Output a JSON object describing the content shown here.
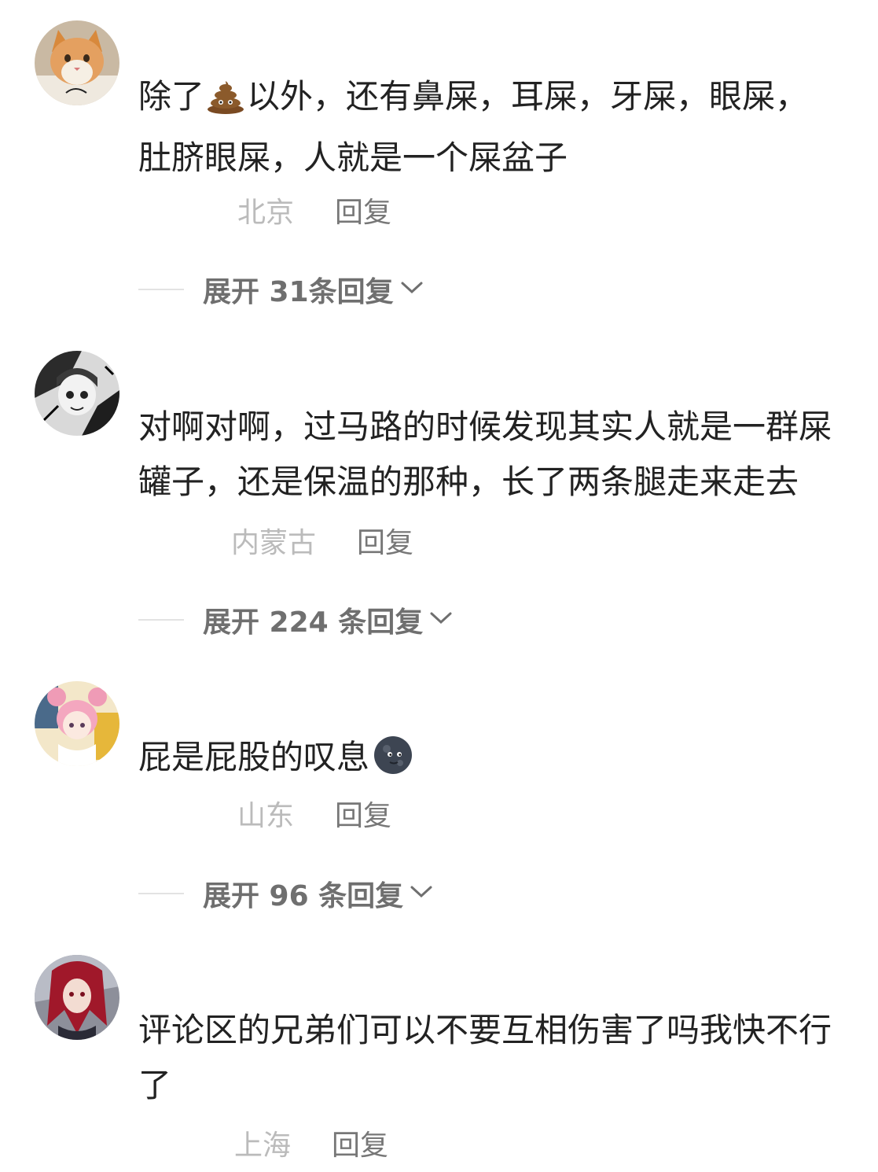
{
  "comments": [
    {
      "avatar_icon": "cat-avatar",
      "lines": [
        "除了",
        "以外，还有鼻屎，耳屎，牙屎，眼屎，",
        "肚脐眼屎，人就是一个屎盆子"
      ],
      "emoji": "poop-emoji",
      "region": "北京",
      "reply_label": "回复",
      "expand_label": "展开 31条回复"
    },
    {
      "avatar_icon": "manga-avatar",
      "lines": [
        "对啊对啊，过马路的时候发现其实人就是一群屎",
        "罐子，还是保温的那种，长了两条腿走来走去"
      ],
      "region": "内蒙古",
      "reply_label": "回复",
      "expand_label": "展开 224 条回复"
    },
    {
      "avatar_icon": "anime-girl-avatar",
      "lines": [
        "屁是屁股的叹息"
      ],
      "emoji": "new-moon-face-emoji",
      "region": "山东",
      "reply_label": "回复",
      "expand_label": "展开 96 条回复"
    },
    {
      "avatar_icon": "red-hair-avatar",
      "lines": [
        "评论区的兄弟们可以不要互相伤害了吗我快不行",
        "了"
      ],
      "region": "上海",
      "reply_label": "回复"
    }
  ],
  "colors": {
    "text": "#222222",
    "region": "#bbbbbb",
    "reply": "#777777",
    "expand": "#6f6f6f"
  }
}
